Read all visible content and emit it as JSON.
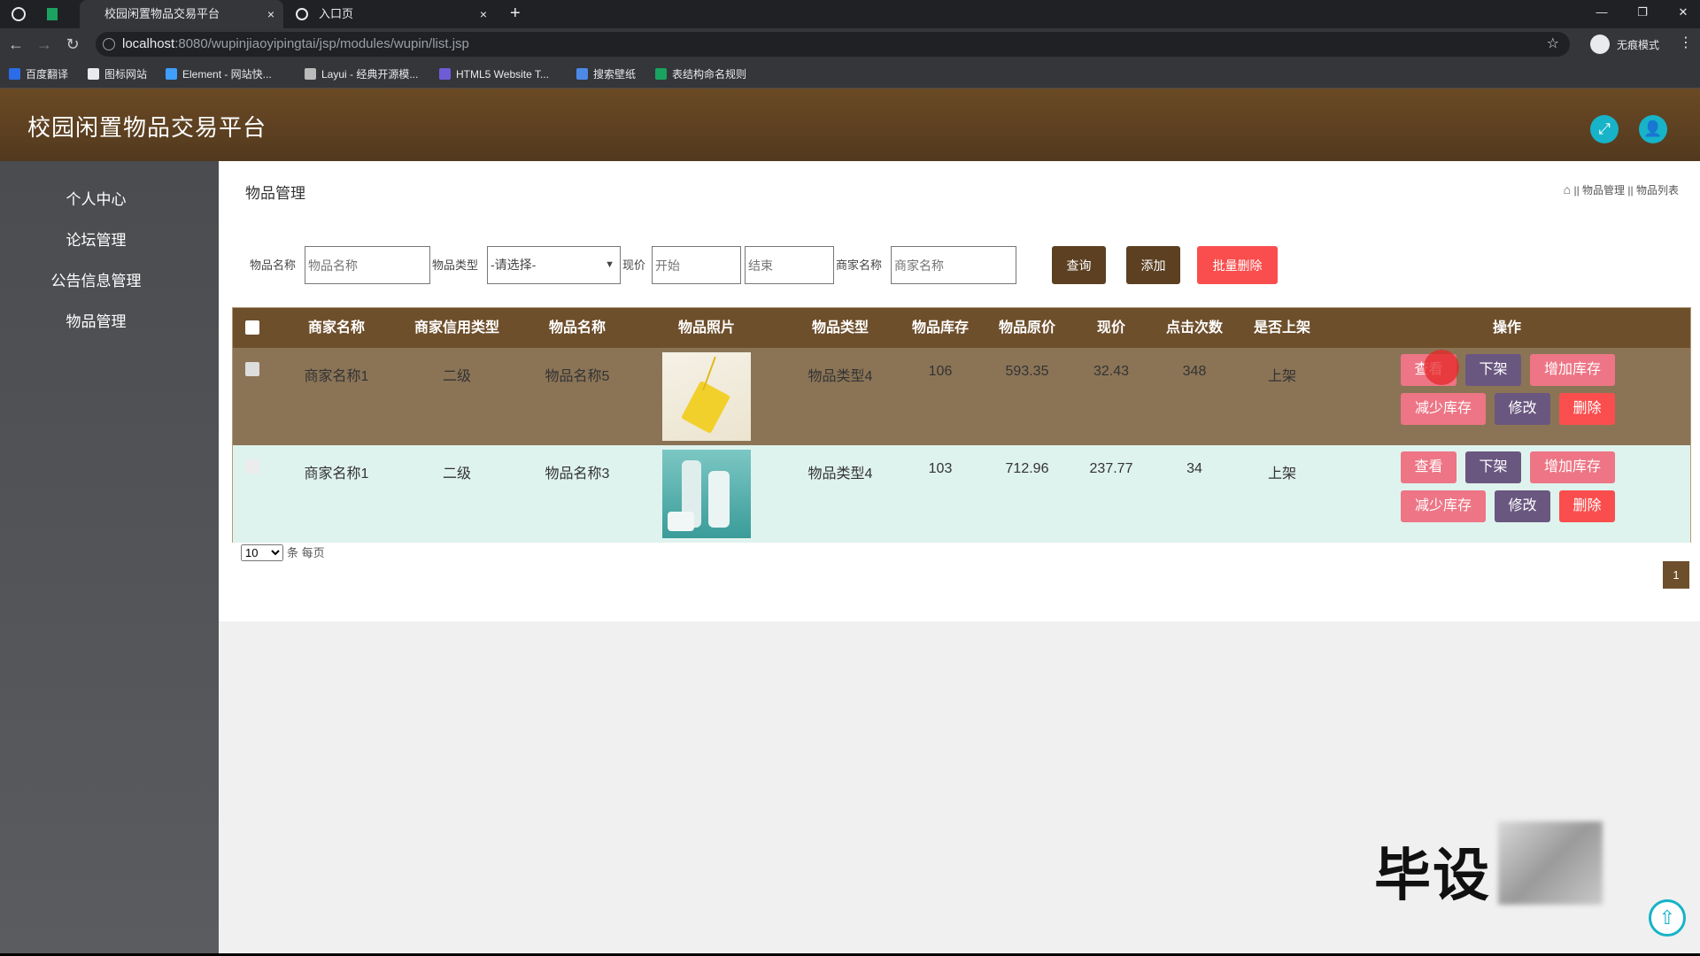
{
  "browser": {
    "tabs": [
      {
        "label": "校园闲置物品交易平台",
        "close": "×"
      },
      {
        "label": "入口页",
        "close": "×"
      }
    ],
    "new_tab": "+",
    "url_host": "localhost",
    "url_path": ":8080/wupinjiaoyipingtai/jsp/modules/wupin/list.jsp",
    "profile_label": "无痕模式",
    "bookmarks": [
      "百度翻译",
      "图标网站",
      "Element - 网站快...",
      "Layui - 经典开源模...",
      "HTML5 Website T...",
      "搜索壁纸",
      "表结构命名规则"
    ]
  },
  "header": {
    "brand": "校园闲置物品交易平台"
  },
  "sidebar": {
    "items": [
      "个人中心",
      "论坛管理",
      "公告信息管理",
      "物品管理"
    ]
  },
  "main": {
    "title": "物品管理",
    "breadcrumb": [
      "物品管理",
      "物品列表"
    ],
    "breadcrumb_sep": "||",
    "search": {
      "name_label": "物品名称",
      "name_placeholder": "物品名称",
      "type_label": "物品类型",
      "type_selected": "-请选择-",
      "price_label": "现价",
      "price_start_placeholder": "开始",
      "price_end_placeholder": "结束",
      "merchant_label": "商家名称",
      "merchant_placeholder": "商家名称",
      "query_button": "查询",
      "add_button": "添加",
      "batch_delete_button": "批量删除"
    },
    "table": {
      "columns": [
        "商家名称",
        "商家信用类型",
        "物品名称",
        "物品照片",
        "物品类型",
        "物品库存",
        "物品原价",
        "现价",
        "点击次数",
        "是否上架",
        "操作"
      ],
      "rows": [
        {
          "merchant": "商家名称1",
          "credit": "二级",
          "name": "物品名称5",
          "type": "物品类型4",
          "stock": "106",
          "original_price": "593.35",
          "price": "32.43",
          "clicks": "348",
          "listed": "上架"
        },
        {
          "merchant": "商家名称1",
          "credit": "二级",
          "name": "物品名称3",
          "type": "物品类型4",
          "stock": "103",
          "original_price": "712.96",
          "price": "237.77",
          "clicks": "34",
          "listed": "上架"
        }
      ],
      "actions": {
        "view": "查看",
        "offline": "下架",
        "add_stock": "增加库存",
        "reduce_stock": "减少库存",
        "edit": "修改",
        "delete": "删除"
      }
    },
    "pagination": {
      "page_size": "10",
      "per_page_label": "条 每页",
      "current_page": "1"
    }
  },
  "overlay": {
    "watermark": "毕设"
  },
  "colors": {
    "header": "#5c4021",
    "table_header": "#6e4f2c",
    "row1": "#8b7456",
    "row2": "#dff3ee",
    "danger": "#fa4e4e",
    "view": "#ed7585",
    "offline": "#6a5780",
    "cyan": "#17b3c8"
  }
}
